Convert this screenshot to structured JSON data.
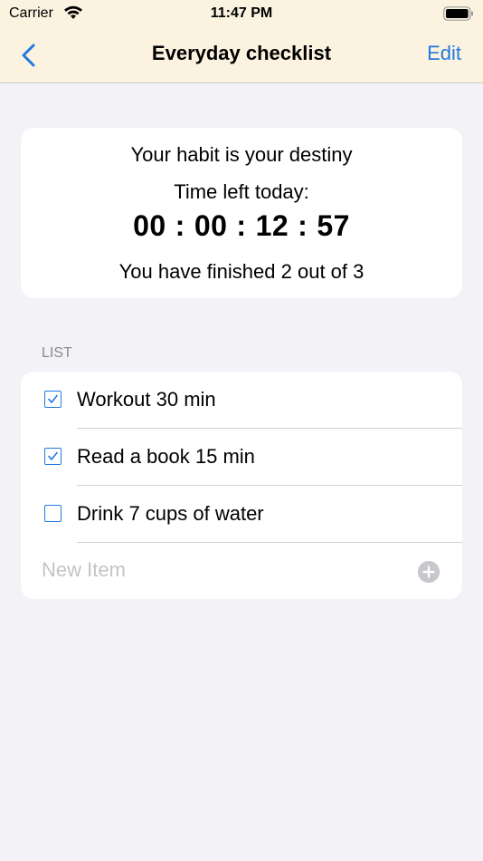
{
  "status": {
    "carrier": "Carrier",
    "time": "11:47 PM"
  },
  "nav": {
    "title": "Everyday checklist",
    "edit_label": "Edit"
  },
  "summary": {
    "motto": "Your habit is your destiny",
    "time_left_label": "Time left today:",
    "countdown": [
      "00",
      "00",
      "12",
      "57"
    ],
    "progress_text": "You have finished 2 out of 3"
  },
  "list": {
    "header": "LIST",
    "items": [
      {
        "label": "Workout 30 min",
        "checked": true
      },
      {
        "label": "Read a book 15 min",
        "checked": true
      },
      {
        "label": "Drink 7 cups of water",
        "checked": false
      }
    ],
    "new_item_placeholder": "New Item"
  },
  "colors": {
    "accent": "#1f7ae0",
    "nav_background": "#fbf3e0",
    "page_background": "#f2f2f7"
  },
  "icons": {
    "back": "chevron-left-icon",
    "wifi": "wifi-icon",
    "battery": "battery-icon",
    "checkbox": "checkbox-icon",
    "add": "plus-circle-icon"
  }
}
